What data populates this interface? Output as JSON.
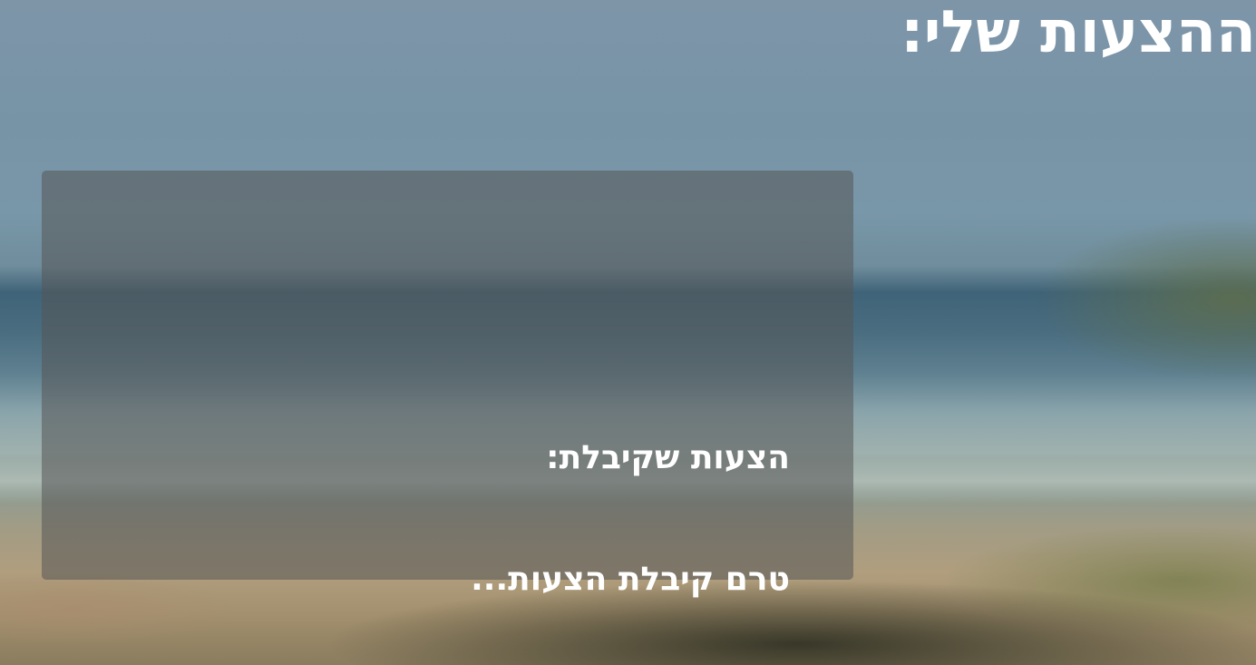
{
  "page": {
    "title": "ההצעות שלי:"
  },
  "offers_panel": {
    "heading": "הצעות שקיבלת:",
    "empty_message": "טרם קיבלת הצעות..."
  }
}
